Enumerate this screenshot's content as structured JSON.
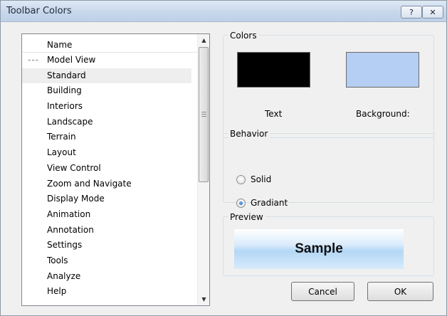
{
  "window": {
    "title": "Toolbar Colors",
    "help_label": "?",
    "close_label": "✕"
  },
  "list": {
    "column_header": "Name",
    "tree_prefix": "---",
    "items": [
      "Model View",
      "Standard",
      "Building",
      "Interiors",
      "Landscape",
      "Terrain",
      "Layout",
      "View Control",
      "Zoom and Navigate",
      "Display Mode",
      "Animation",
      "Annotation",
      "Settings",
      "Tools",
      "Analyze",
      "Help"
    ],
    "selected_item": "Standard",
    "scroll_up_icon": "triangle-up",
    "scroll_down_icon": "triangle-down"
  },
  "colors": {
    "legend": "Colors",
    "text_label": "Text",
    "background_label": "Background:",
    "text_color": "#000000",
    "background_color": "#b5cef4"
  },
  "behavior": {
    "legend": "Behavior",
    "solid_label": "Solid",
    "gradient_label": "Gradiant",
    "selected": "Gradiant"
  },
  "preview": {
    "legend": "Preview",
    "sample_text": "Sample"
  },
  "buttons": {
    "cancel_label": "Cancel",
    "ok_label": "OK"
  }
}
